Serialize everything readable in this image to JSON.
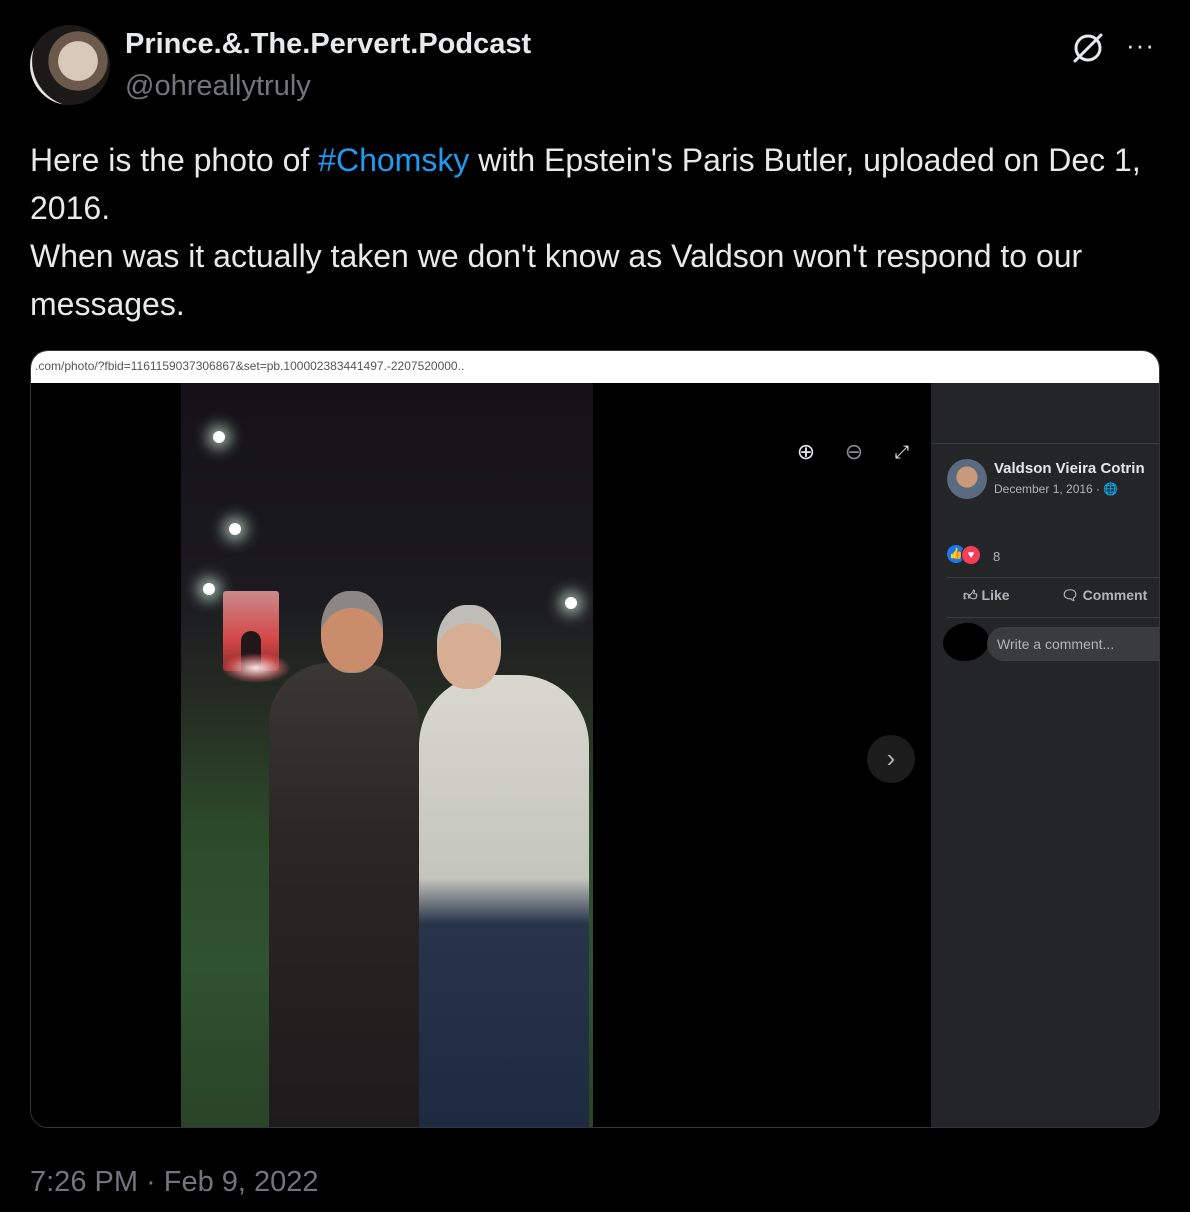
{
  "tweet": {
    "display_name": "Prince.&.The.Pervert.Podcast",
    "handle": "@ohreallytruly",
    "text_before_hashtag": "Here is the photo of ",
    "hashtag": "#Chomsky",
    "text_after_hashtag": " with Epstein's Paris Butler, uploaded on Dec 1, 2016.",
    "text_line2": "When was it actually taken we don't know as Valdson won't respond to our messages.",
    "timestamp": "7:26 PM · Feb 9, 2022",
    "more_label": "···",
    "hashtag_color": "#1d9bf0"
  },
  "embedded_screenshot": {
    "url": ".com/photo/?fbid=1161159037306867&set=pb.100002383441497.-2207520000..",
    "viewer": {
      "zoom_in_icon": "⊕",
      "zoom_out_icon": "⊖",
      "expand_icon": "⤢",
      "next_icon": "›"
    },
    "post": {
      "poster_name": "Valdson Vieira Cotrin",
      "date": "December 1, 2016 · 🌐",
      "reaction_count": "8",
      "like_label": "Like",
      "comment_label": "Comment",
      "comment_placeholder": "Write a comment..."
    }
  }
}
